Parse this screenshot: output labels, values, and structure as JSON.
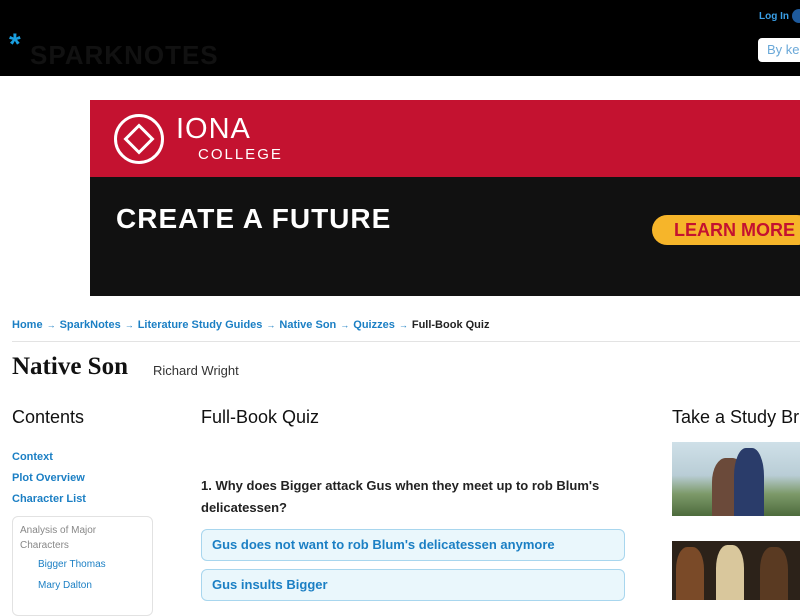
{
  "header": {
    "logo_star": "*",
    "logo_text": "SPARKNOTES",
    "login_label": "Log In",
    "search_placeholder": "By ke"
  },
  "ad": {
    "brand": "IONA",
    "brand_sub": "COLLEGE",
    "headline": "CREATE A FUTURE",
    "cta_label": "LEARN MORE",
    "colors": {
      "red": "#c41230",
      "black": "#111111",
      "cta": "#f6b52a"
    }
  },
  "breadcrumb": {
    "items": [
      "Home",
      "SparkNotes",
      "Literature Study Guides",
      "Native Son",
      "Quizzes"
    ],
    "separator": "→",
    "current": "Full-Book Quiz"
  },
  "book": {
    "title": "Native Son",
    "author": "Richard Wright"
  },
  "sidebar": {
    "heading": "Contents",
    "links": [
      "Context",
      "Plot Overview",
      "Character List"
    ],
    "section_heading": "Analysis of Major Characters",
    "sub_links": [
      "Bigger Thomas",
      "Mary Dalton"
    ]
  },
  "quiz": {
    "heading": "Full-Book Quiz",
    "question": "1. Why does Bigger attack Gus when they meet up to rob Blum's delicatessen?",
    "answers": [
      "Gus does not want to rob Blum's delicatessen anymore",
      "Gus insults Bigger"
    ]
  },
  "study_break": {
    "heading": "Take a Study Br"
  },
  "colors": {
    "link": "#1b7fc4",
    "answer_bg": "#eaf7fc",
    "answer_border": "#a8d6ee"
  }
}
